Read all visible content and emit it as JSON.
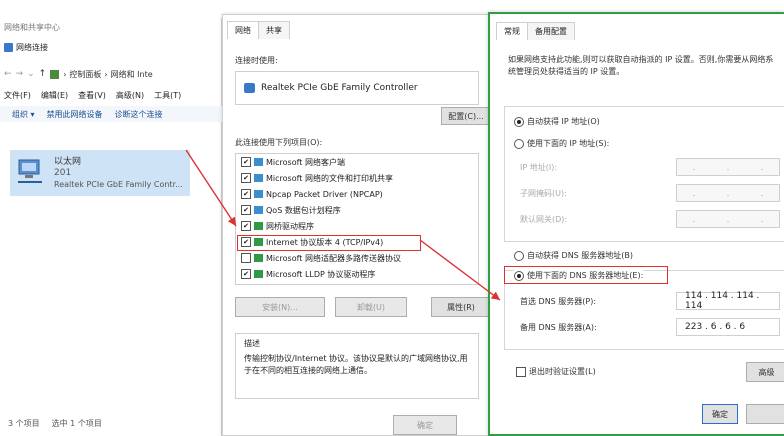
{
  "window1": {
    "title": "网络和共享中心",
    "path_title": "网络连接",
    "breadcrumb": [
      "控制面板",
      "网络和 Inte"
    ],
    "menu": [
      "文件(F)",
      "编辑(E)",
      "查看(V)",
      "高级(N)",
      "工具(T)"
    ],
    "commands": [
      "组织 ▾",
      "禁用此网络设备",
      "诊断这个连接"
    ],
    "adapter": {
      "name": "以太网",
      "network": "201",
      "device": "Realtek PCIe GbE Family Contr..."
    },
    "status": [
      "3 个项目",
      "选中 1 个项目"
    ]
  },
  "window2": {
    "tabs": [
      "网络",
      "共享"
    ],
    "connect_using_label": "连接时使用:",
    "device": "Realtek PCIe GbE Family Controller",
    "configure_button": "配置(C)...",
    "items_label": "此连接使用下列项目(O):",
    "items": [
      {
        "label": "Microsoft 网络客户端",
        "checked": true
      },
      {
        "label": "Microsoft 网络的文件和打印机共享",
        "checked": true
      },
      {
        "label": "Npcap Packet Driver (NPCAP)",
        "checked": true
      },
      {
        "label": "QoS 数据包计划程序",
        "checked": true
      },
      {
        "label": "网桥驱动程序",
        "checked": true
      },
      {
        "label": "Internet 协议版本 4 (TCP/IPv4)",
        "checked": true
      },
      {
        "label": "Microsoft 网络适配器多路传送器协议",
        "checked": false
      },
      {
        "label": "Microsoft LLDP 协议驱动程序",
        "checked": true
      }
    ],
    "install_button": "安装(N)...",
    "uninstall_button": "卸载(U)",
    "properties_button": "属性(R)",
    "description_title": "描述",
    "description": "传输控制协议/Internet 协议。该协议是默认的广域网络协议,用于在不同的相互连接的网络上通信。",
    "ok_button": "确定"
  },
  "window3": {
    "tabs": [
      "常规",
      "备用配置"
    ],
    "intro": "如果网络支持此功能,则可以获取自动指派的 IP 设置。否则,你需要从网络系统管理员处获得适当的 IP 设置。",
    "auto_ip": "自动获得 IP 地址(O)",
    "manual_ip": "使用下面的 IP 地址(S):",
    "ip_label": "IP 地址(I):",
    "mask_label": "子网掩码(U):",
    "gateway_label": "默认网关(D):",
    "auto_dns": "自动获得 DNS 服务器地址(B)",
    "manual_dns": "使用下面的 DNS 服务器地址(E):",
    "preferred_dns_label": "首选 DNS 服务器(P):",
    "preferred_dns": "114 . 114 . 114 . 114",
    "alternate_dns_label": "备用 DNS 服务器(A):",
    "alternate_dns": "223 . 6 . 6 . 6",
    "validate_label": "退出时验证设置(L)",
    "advanced_button": "高级",
    "ok_button": "确定",
    "empty_ip_placeholder": "."
  },
  "colors": {
    "highlight": "#e03030",
    "frame": "#2ea043",
    "selection": "#cfe3f7"
  }
}
